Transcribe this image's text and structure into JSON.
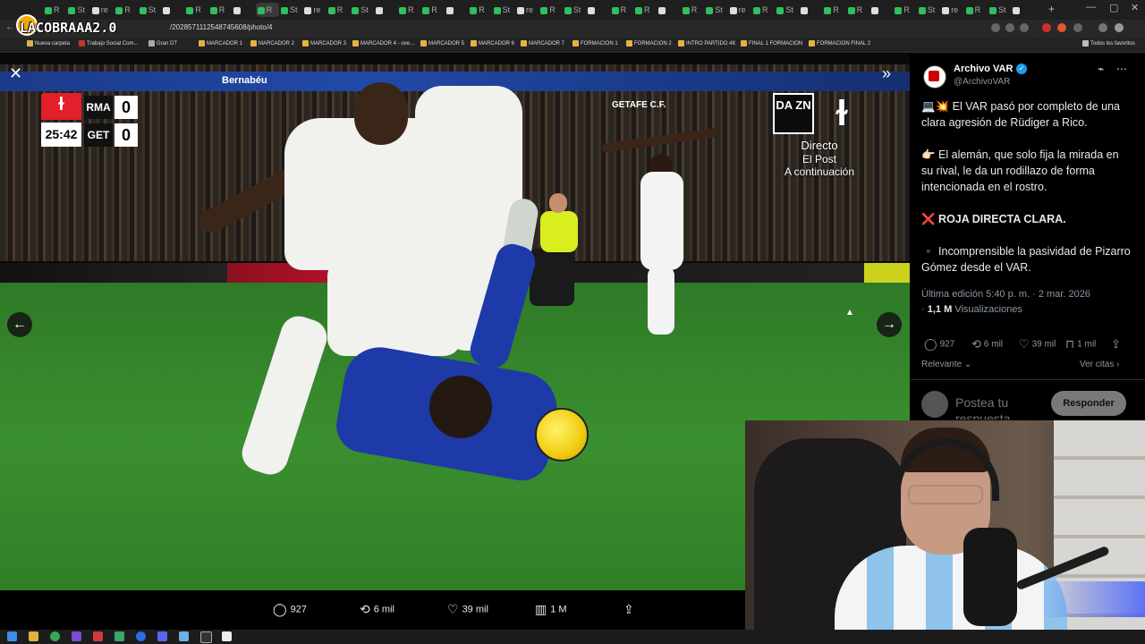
{
  "browser": {
    "tabs": [
      {
        "label": "R",
        "color": "#2fbf5e"
      },
      {
        "label": "St",
        "color": "#2fbf5e"
      },
      {
        "label": "re",
        "color": "#ddd"
      },
      {
        "label": "R",
        "color": "#2fbf5e"
      },
      {
        "label": "St",
        "color": "#2fbf5e"
      },
      {
        "label": "",
        "color": "#ddd"
      },
      {
        "label": "R",
        "color": "#2fbf5e"
      },
      {
        "label": "R",
        "color": "#2fbf5e"
      },
      {
        "label": "",
        "color": "#ddd"
      }
    ],
    "url": "/2028571112548745608/photo/4",
    "bookmarks": [
      "Nueva carpeta",
      "Trabajo Social Com...",
      "Gran DT",
      "MARCADOR 1",
      "MARCADOR 2",
      "MARCADOR 3",
      "MARCADOR 4 - ove...",
      "MARCADOR 5",
      "MARCADOR 6",
      "MARCADOR 7",
      "FORMACION 1",
      "FORMACION 2",
      "INTRO PARTIDO 4K",
      "FINAL 1 FORMACION",
      "FORMACION FINAL 2"
    ],
    "all_favorites": "Todos los favoritos"
  },
  "overlay": {
    "streamer_name": "LACOBRAAA2.0"
  },
  "scoreboard": {
    "home_team": "RMA",
    "home_score": "0",
    "away_team": "GET",
    "away_score": "0",
    "clock": "25:42"
  },
  "broadcast": {
    "stadium_banner": "Bernabéu",
    "team_banner": "GETAFE C.F.",
    "dazn": "DA ZN",
    "line1": "Directo",
    "line2": "El Post",
    "line3": "A continuación"
  },
  "actions": {
    "replies": "927",
    "reposts": "6 mil",
    "likes": "39 mil",
    "views": "1 M"
  },
  "post": {
    "account_name": "Archivo VAR",
    "handle": "@ArchivoVAR",
    "p1": "💻💥 El VAR pasó por completo de una clara agresión de Rüdiger a Rico.",
    "p2": "👉🏻 El alemán, que solo fija la mirada en su rival, le da un rodillazo de forma intencionada en el rostro.",
    "p3": "❌ ROJA DIRECTA CLARA.",
    "p4": "▪️ Incomprensible la pasividad de Pizarro Gómez desde el VAR.",
    "edited": "Última edición 5:40 p. m. · 2 mar. 2026",
    "views_count": "1,1 M",
    "views_label": "Visualizaciones",
    "stats": {
      "replies": "927",
      "reposts": "6 mil",
      "likes": "39 mil",
      "bookmarks": "1 mil"
    },
    "sort_label": "Relevante",
    "quotes_label": "Ver citas",
    "reply_placeholder": "Postea tu respuesta",
    "reply_button": "Responder"
  },
  "colors": {
    "accent_blue": "#1d9bf0",
    "laliga_red": "#e21f2a",
    "pitch_green": "#3a8f2f",
    "ball_yellow": "#f0cc10"
  }
}
